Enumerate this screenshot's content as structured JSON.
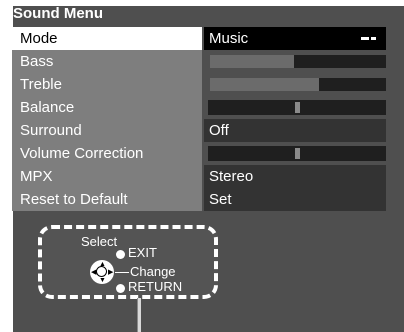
{
  "menu": {
    "title": "Sound Menu",
    "items": [
      {
        "label": "Mode",
        "value": "Music",
        "selected": true
      },
      {
        "label": "Bass",
        "level": 0.48
      },
      {
        "label": "Treble",
        "level": 0.62
      },
      {
        "label": "Balance",
        "position": 0.5
      },
      {
        "label": "Surround",
        "value": "Off"
      },
      {
        "label": "Volume Correction",
        "position": 0.5
      },
      {
        "label": "MPX",
        "value": "Stereo"
      },
      {
        "label": "Reset to Default",
        "value": "Set"
      }
    ]
  },
  "help": {
    "select": "Select",
    "exit": "EXIT",
    "change": "Change",
    "return": "RETURN"
  },
  "icons": {
    "dpad": "dpad-icon",
    "bullet": "bullet-icon"
  },
  "colors": {
    "background": "#4f4f4f",
    "selected_label": "#ffffff",
    "selected_value": "#000000"
  }
}
